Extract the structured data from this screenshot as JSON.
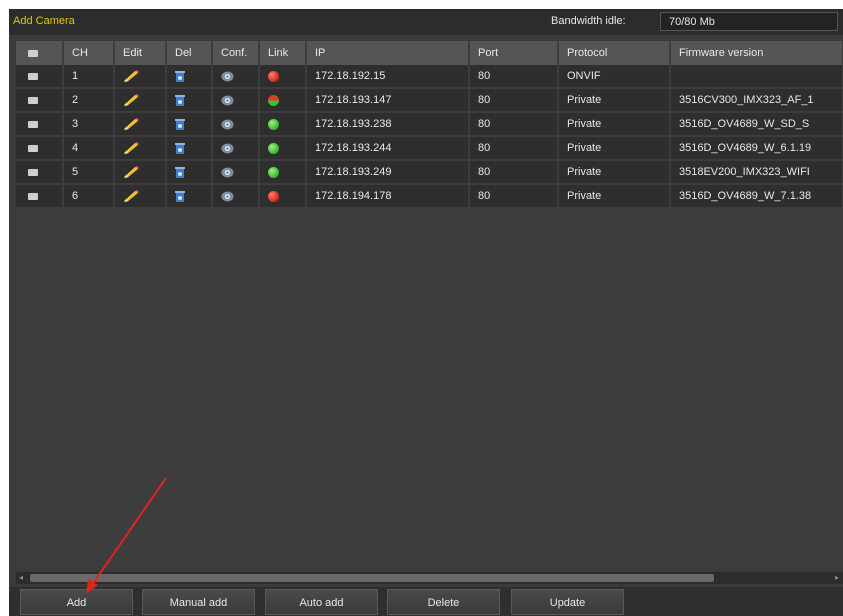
{
  "window": {
    "title": "Add Camera",
    "bandwidth_label": "Bandwidth idle:",
    "bandwidth_value": "70/80 Mb"
  },
  "table": {
    "columns": [
      "",
      "CH",
      "Edit",
      "Del",
      "Conf.",
      "Link",
      "IP",
      "Port",
      "Protocol",
      "Firmware version"
    ],
    "rows": [
      {
        "ch": "1",
        "link": "red",
        "ip": "172.18.192.15",
        "port": "80",
        "protocol": "ONVIF",
        "firmware": ""
      },
      {
        "ch": "2",
        "link": "mixed",
        "ip": "172.18.193.147",
        "port": "80",
        "protocol": "Private",
        "firmware": "3516CV300_IMX323_AF_1"
      },
      {
        "ch": "3",
        "link": "green",
        "ip": "172.18.193.238",
        "port": "80",
        "protocol": "Private",
        "firmware": "3516D_OV4689_W_SD_S"
      },
      {
        "ch": "4",
        "link": "green",
        "ip": "172.18.193.244",
        "port": "80",
        "protocol": "Private",
        "firmware": "3516D_OV4689_W_6.1.19"
      },
      {
        "ch": "5",
        "link": "green",
        "ip": "172.18.193.249",
        "port": "80",
        "protocol": "Private",
        "firmware": "3518EV200_IMX323_WIFI"
      },
      {
        "ch": "6",
        "link": "red",
        "ip": "172.18.194.178",
        "port": "80",
        "protocol": "Private",
        "firmware": "3516D_OV4689_W_7.1.38"
      }
    ]
  },
  "buttons": {
    "add": "Add",
    "manual_add": "Manual add",
    "auto_add": "Auto add",
    "delete": "Delete",
    "update": "Update"
  },
  "icons": {
    "edit": "pencil-icon",
    "delete": "trash-icon",
    "config": "gear-icon",
    "link": "status-dot-icon"
  },
  "colors": {
    "title": "#e6c400",
    "link_ok": "#2fb82a",
    "link_error": "#d8251a",
    "annotation_arrow": "#e0241b"
  }
}
